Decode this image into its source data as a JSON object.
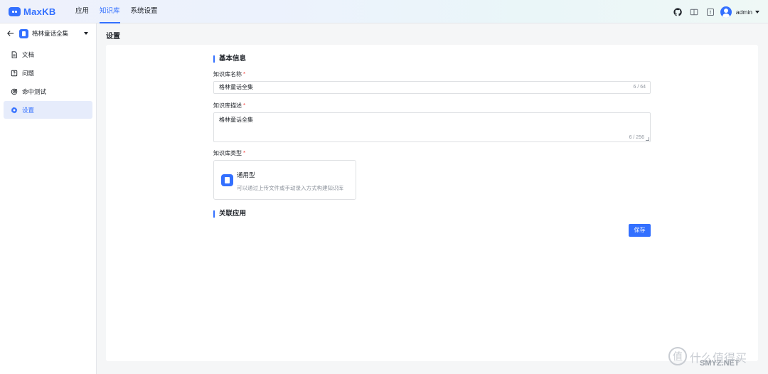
{
  "app": {
    "name": "MaxKB"
  },
  "nav": {
    "items": [
      "应用",
      "知识库",
      "系统设置"
    ],
    "active": 1
  },
  "topbar": {
    "user": "admin",
    "icons": [
      "github-icon",
      "book-icon",
      "help-icon"
    ]
  },
  "sidebar": {
    "kb_name": "格林童话全集",
    "items": [
      {
        "label": "文档",
        "icon": "document-icon"
      },
      {
        "label": "问题",
        "icon": "question-icon"
      },
      {
        "label": "命中测试",
        "icon": "target-icon"
      },
      {
        "label": "设置",
        "icon": "gear-icon"
      }
    ],
    "active": 3
  },
  "page": {
    "title": "设置"
  },
  "form": {
    "basic_section": "基本信息",
    "name_label": "知识库名称",
    "name_value": "格林童话全集",
    "name_count": "6 / 64",
    "desc_label": "知识库描述",
    "desc_value": "格林童话全集",
    "desc_count": "6 / 256",
    "type_label": "知识库类型",
    "type_name": "通用型",
    "type_desc": "可以通过上传文件或手动录入方式构建知识库",
    "assoc_section": "关联应用",
    "save_label": "保存",
    "required_mark": "*"
  },
  "watermark": {
    "text": "什么值得买",
    "glyph": "值",
    "site": "SMYZ.NET"
  },
  "colors": {
    "accent": "#3370ff",
    "required": "#f54a45"
  }
}
